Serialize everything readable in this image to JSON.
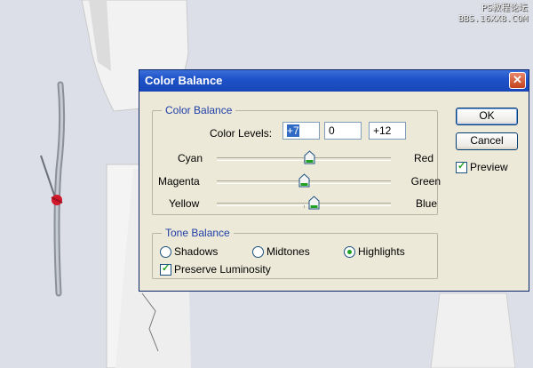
{
  "watermark": {
    "line1": "PS教程论坛",
    "line2": "BBS.16XX8.COM"
  },
  "dialog": {
    "title": "Color Balance",
    "close_glyph": "✕",
    "color_balance_group": {
      "title": "Color Balance",
      "levels_label": "Color Levels:",
      "levels": [
        "+7",
        "0",
        "+12"
      ]
    },
    "sliders": [
      {
        "left": "Cyan",
        "right": "Red",
        "value": 7
      },
      {
        "left": "Magenta",
        "right": "Green",
        "value": 0
      },
      {
        "left": "Yellow",
        "right": "Blue",
        "value": 12
      }
    ],
    "tone_group": {
      "title": "Tone Balance",
      "options": [
        "Shadows",
        "Midtones",
        "Highlights"
      ],
      "selected": "Highlights",
      "preserve_label": "Preserve Luminosity",
      "preserve_checked": true
    },
    "buttons": {
      "ok": "OK",
      "cancel": "Cancel"
    },
    "preview_label": "Preview",
    "preview_checked": true
  },
  "colors": {
    "accent": "#316ac5",
    "titlebar": "#1f53c9",
    "check": "#21a121"
  }
}
